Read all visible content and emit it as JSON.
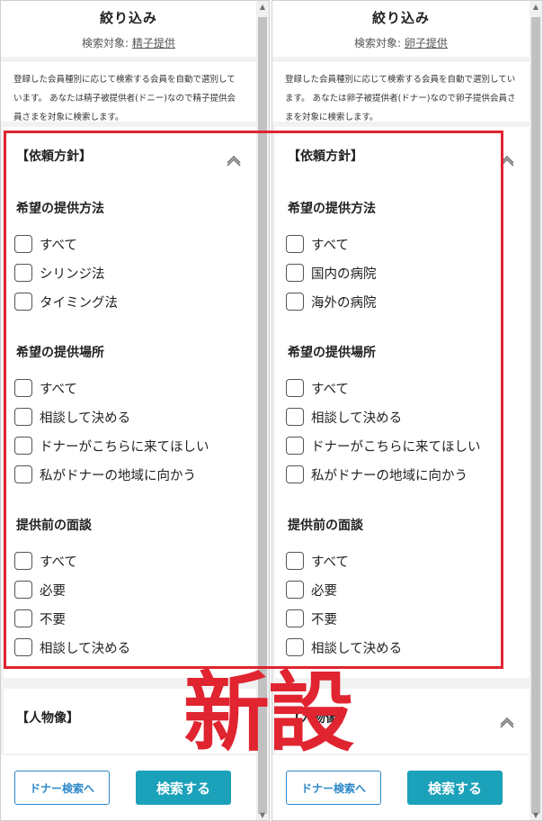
{
  "colors": {
    "highlight": "#e02430",
    "accent_blue": "#2b87c9",
    "button_teal": "#1ba1b9"
  },
  "annotation": {
    "stamp_text": "新設"
  },
  "panels": [
    {
      "title": "絞り込み",
      "target_prefix": "検索対象:",
      "target_link": "精子提供",
      "note": "登録した会員種別に応じて検索する会員を自動で選別しています。 あなたは精子被提供者(ドニー)なので精子提供会員さまを対象に検索します。",
      "section_label": "【依頼方針】",
      "group1": {
        "title": "希望の提供方法",
        "options": [
          "すべて",
          "シリンジ法",
          "タイミング法"
        ]
      },
      "group2": {
        "title": "希望の提供場所",
        "options": [
          "すべて",
          "相談して決める",
          "ドナーがこちらに来てほしい",
          "私がドナーの地域に向かう"
        ]
      },
      "group3": {
        "title": "提供前の面談",
        "options": [
          "すべて",
          "必要",
          "不要",
          "相談して決める"
        ]
      },
      "section2_label": "【人物像】",
      "btn_secondary": "ドナー検索へ",
      "btn_primary": "検索する"
    },
    {
      "title": "絞り込み",
      "target_prefix": "検索対象:",
      "target_link": "卵子提供",
      "note": "登録した会員種別に応じて検索する会員を自動で選別しています。 あなたは卵子被提供者(ドナー)なので卵子提供会員さまを対象に検索します。",
      "section_label": "【依頼方針】",
      "group1": {
        "title": "希望の提供方法",
        "options": [
          "すべて",
          "国内の病院",
          "海外の病院"
        ]
      },
      "group2": {
        "title": "希望の提供場所",
        "options": [
          "すべて",
          "相談して決める",
          "ドナーがこちらに来てほしい",
          "私がドナーの地域に向かう"
        ]
      },
      "group3": {
        "title": "提供前の面談",
        "options": [
          "すべて",
          "必要",
          "不要",
          "相談して決める"
        ]
      },
      "section2_label": "【人物像】",
      "btn_secondary": "ドナー検索へ",
      "btn_primary": "検索する"
    }
  ]
}
